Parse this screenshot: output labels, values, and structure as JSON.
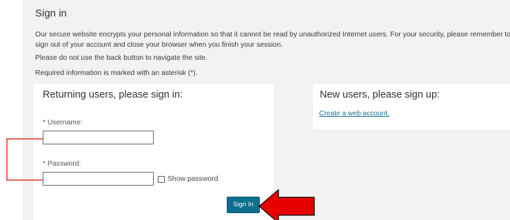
{
  "page": {
    "title": "Sign in",
    "intro": "Our secure website encrypts your personal information so that it cannot be read by unauthorized Internet users. For your security, please remember to sign out of your account and close your browser when you finish your session.",
    "back_note": "Please do not use the back button to navigate the site.",
    "required_note": "Required information is marked with an asterisk (*)."
  },
  "returning": {
    "heading": "Returning users, please sign in:",
    "username_label": "* Username:",
    "username_value": "",
    "password_label": "* Password:",
    "password_value": "",
    "show_password_label": "Show password",
    "show_password_checked": false,
    "signin_label": "Sign In"
  },
  "new_users": {
    "heading": "New users, please sign up:",
    "link_label": "Create a web account."
  },
  "annotations": {
    "bracket_color": "#e03020",
    "arrow_color": "#e60000",
    "arrow_outline": "#000000"
  }
}
